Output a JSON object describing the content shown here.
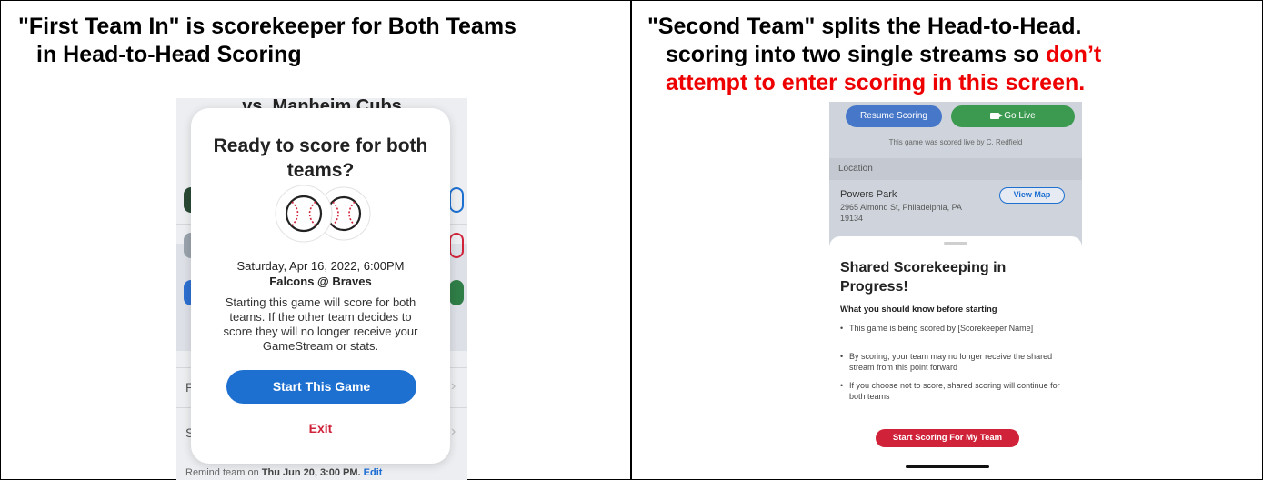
{
  "left": {
    "title_line1": "\"First Team In\" is scorekeeper for Both Teams",
    "title_line2": "in Head-to-Head Scoring"
  },
  "right": {
    "title_line1": "\"Second Team\" splits the Head-to-Head.",
    "title_line2": "scoring into two single streams so ",
    "title_red_part": "don’t",
    "title_line3": "attempt to enter scoring in this screen."
  },
  "phone1": {
    "background_title": "vs. Manheim Cubs",
    "background_letters": [
      "P",
      "S"
    ],
    "remind_prefix": "Remind team on",
    "remind_date": "Thu Jun 20, 3:00 PM.",
    "remind_edit": "Edit",
    "modal": {
      "title": "Ready to score for both teams?",
      "date": "Saturday, Apr 16, 2022, 6:00PM",
      "matchup": "Falcons @ Braves",
      "body": "Starting this game will score for both teams. If the other team decides to score they will no longer receive your GameStream or stats.",
      "start_button": "Start This Game",
      "exit_button": "Exit"
    }
  },
  "phone2": {
    "resume_button": "Resume Scoring",
    "go_live_button": "Go Live",
    "scored_by": "This game was scored live by C. Redfield",
    "location_header": "Location",
    "park_name": "Powers Park",
    "address": "2965 Almond St, Philadelphia, PA 19134",
    "view_map_button": "View Map",
    "sheet": {
      "title": "Shared Scorekeeping in Progress!",
      "subtitle": "What you should know before starting",
      "bullets": [
        "This game is being scored by [Scorekeeper Name]",
        "By scoring, your team may no longer receive the shared stream from this point forward",
        "If you choose not to score, shared scoring will continue for both teams"
      ],
      "start_button": "Start Scoring For My Team"
    }
  },
  "colors": {
    "primary_blue": "#1d6fd0",
    "danger_red": "#d0233a",
    "live_green": "#3b9a4f",
    "callout_red": "#ee0000"
  }
}
